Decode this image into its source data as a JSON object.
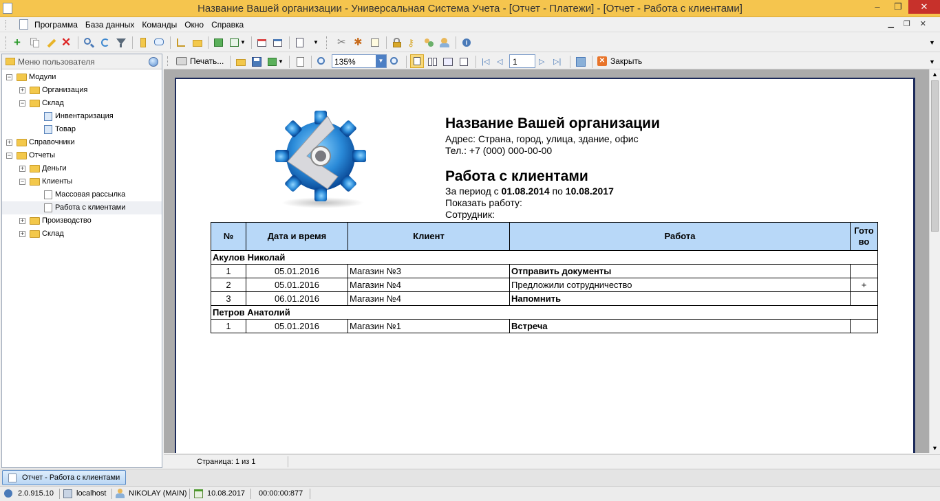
{
  "window": {
    "title": "Название Вашей организации - Универсальная Система Учета - [Отчет - Платежи] - [Отчет - Работа с клиентами]"
  },
  "menu": {
    "items": [
      "Программа",
      "База данных",
      "Команды",
      "Окно",
      "Справка"
    ]
  },
  "left_panel": {
    "header": "Меню пользователя",
    "tree": [
      {
        "label": "Модули",
        "level": 0,
        "kind": "folder",
        "state": "minus"
      },
      {
        "label": "Организация",
        "level": 1,
        "kind": "folder",
        "state": "plus"
      },
      {
        "label": "Склад",
        "level": 1,
        "kind": "folder",
        "state": "minus"
      },
      {
        "label": "Инвентаризация",
        "level": 2,
        "kind": "page"
      },
      {
        "label": "Товар",
        "level": 2,
        "kind": "page"
      },
      {
        "label": "Справочники",
        "level": 0,
        "kind": "folder",
        "state": "plus"
      },
      {
        "label": "Отчеты",
        "level": 0,
        "kind": "folder",
        "state": "minus"
      },
      {
        "label": "Деньги",
        "level": 1,
        "kind": "folder",
        "state": "plus"
      },
      {
        "label": "Клиенты",
        "level": 1,
        "kind": "folder",
        "state": "minus"
      },
      {
        "label": "Массовая рассылка",
        "level": 2,
        "kind": "doc"
      },
      {
        "label": "Работа с клиентами",
        "level": 2,
        "kind": "doc",
        "selected": true
      },
      {
        "label": "Производство",
        "level": 1,
        "kind": "folder",
        "state": "plus"
      },
      {
        "label": "Склад",
        "level": 1,
        "kind": "folder",
        "state": "plus"
      }
    ]
  },
  "preview_toolbar": {
    "print_label": "Печать...",
    "zoom": "135%",
    "page_number": "1",
    "close_label": "Закрыть"
  },
  "report": {
    "org_name": "Название Вашей организации",
    "address": "Адрес: Страна, город, улица, здание, офис",
    "phone": "Тел.: +7 (000) 000-00-00",
    "title": "Работа с клиентами",
    "period_prefix": "За период с ",
    "period_from": "01.08.2014",
    "period_mid": " по ",
    "period_to": "10.08.2017",
    "show_work": "Показать работу:",
    "employee": "Сотрудник:",
    "columns": [
      "№",
      "Дата и время",
      "Клиент",
      "Работа",
      "Гото во"
    ],
    "groups": [
      {
        "name": "Акулов Николай",
        "rows": [
          {
            "num": "1",
            "date": "05.01.2016",
            "client": "Магазин №3",
            "work": "Отправить документы",
            "bold": true,
            "done": ""
          },
          {
            "num": "2",
            "date": "05.01.2016",
            "client": "Магазин №4",
            "work": "Предложили сотрудничество",
            "bold": false,
            "done": "+"
          },
          {
            "num": "3",
            "date": "06.01.2016",
            "client": "Магазин №4",
            "work": "Напомнить",
            "bold": true,
            "done": ""
          }
        ]
      },
      {
        "name": "Петров Анатолий",
        "rows": [
          {
            "num": "1",
            "date": "05.01.2016",
            "client": "Магазин №1",
            "work": "Встреча",
            "bold": true,
            "done": ""
          }
        ]
      }
    ]
  },
  "status": {
    "page_info": "Страница: 1 из 1"
  },
  "taskbar": {
    "active_tab": "Отчет - Работа с клиентами"
  },
  "bottom": {
    "version": "2.0.915.10",
    "server": "localhost",
    "user": "NIKOLAY (MAIN)",
    "date": "10.08.2017",
    "timer": "00:00:00:877"
  }
}
